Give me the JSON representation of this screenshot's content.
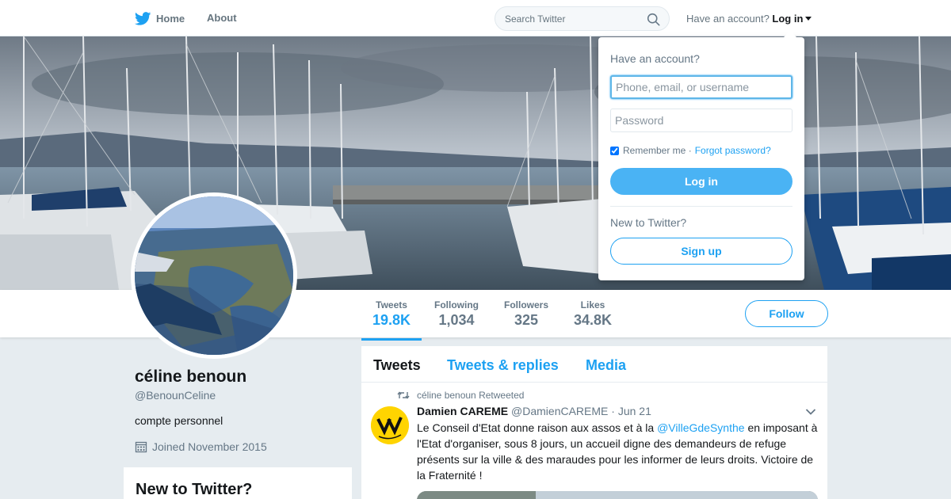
{
  "nav": {
    "home_label": "Home",
    "about_label": "About",
    "search_placeholder": "Search Twitter",
    "have_account_text": "Have an account?",
    "login_label": "Log in"
  },
  "profile": {
    "name": "céline benoun",
    "handle": "@BenounCeline",
    "bio": "compte personnel",
    "joined": "Joined November 2015"
  },
  "stats": [
    {
      "label": "Tweets",
      "value": "19.8K"
    },
    {
      "label": "Following",
      "value": "1,034"
    },
    {
      "label": "Followers",
      "value": "325"
    },
    {
      "label": "Likes",
      "value": "34.8K"
    }
  ],
  "follow_label": "Follow",
  "new_card_title": "New to Twitter?",
  "tabs": [
    "Tweets",
    "Tweets & replies",
    "Media"
  ],
  "tweet": {
    "retweeted_by": "céline benoun Retweeted",
    "author_name": "Damien CAREME",
    "author_handle": "@DamienCAREME",
    "separator": "·",
    "date": "Jun 21",
    "text_before": "Le Conseil d'Etat donne raison aux assos et à la ",
    "mention": "@VilleGdeSynthe",
    "text_after": " en imposant à l'Etat d'organiser, sous 8 jours, un accueil digne des demandeurs de refuge présents sur la ville & des maraudes pour les informer de leurs droits. Victoire de la Fraternité !"
  },
  "login_dropdown": {
    "title": "Have an account?",
    "username_placeholder": "Phone, email, or username",
    "password_placeholder": "Password",
    "remember_label": "Remember me",
    "separator": "·",
    "forgot_label": "Forgot password?",
    "login_button": "Log in",
    "new_text": "New to Twitter?",
    "signup_button": "Sign up"
  },
  "colors": {
    "accent": "#1da1f2",
    "login_button": "#4ab3f4",
    "background": "#e6ecf0"
  }
}
